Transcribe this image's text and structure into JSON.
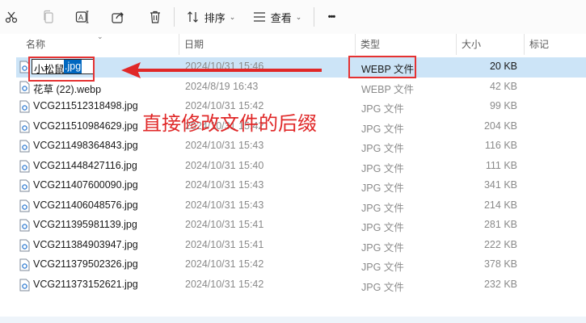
{
  "toolbar": {
    "sort_label": "排序",
    "view_label": "查看",
    "more_label": "•••"
  },
  "columns": {
    "name": "名称",
    "date": "日期",
    "type": "类型",
    "size": "大小",
    "tags": "标记"
  },
  "editing": {
    "plain": "小松鼠",
    "selected": ".jpg"
  },
  "annotation": "直接修改文件的后缀",
  "files": [
    {
      "name": "",
      "date": "2024/10/31 15:46",
      "type": "WEBP 文件",
      "size": "20 KB"
    },
    {
      "name": "花草 (22).webp",
      "date": "2024/8/19 16:43",
      "type": "WEBP 文件",
      "size": "42 KB"
    },
    {
      "name": "VCG211512318498.jpg",
      "date": "2024/10/31 15:42",
      "type": "JPG 文件",
      "size": "99 KB"
    },
    {
      "name": "VCG211510984629.jpg",
      "date": "2024/10/31 15:42",
      "type": "JPG 文件",
      "size": "204 KB"
    },
    {
      "name": "VCG211498364843.jpg",
      "date": "2024/10/31 15:43",
      "type": "JPG 文件",
      "size": "116 KB"
    },
    {
      "name": "VCG211448427116.jpg",
      "date": "2024/10/31 15:40",
      "type": "JPG 文件",
      "size": "111 KB"
    },
    {
      "name": "VCG211407600090.jpg",
      "date": "2024/10/31 15:43",
      "type": "JPG 文件",
      "size": "341 KB"
    },
    {
      "name": "VCG211406048576.jpg",
      "date": "2024/10/31 15:43",
      "type": "JPG 文件",
      "size": "214 KB"
    },
    {
      "name": "VCG211395981139.jpg",
      "date": "2024/10/31 15:41",
      "type": "JPG 文件",
      "size": "281 KB"
    },
    {
      "name": "VCG211384903947.jpg",
      "date": "2024/10/31 15:41",
      "type": "JPG 文件",
      "size": "222 KB"
    },
    {
      "name": "VCG211379502326.jpg",
      "date": "2024/10/31 15:42",
      "type": "JPG 文件",
      "size": "378 KB"
    },
    {
      "name": "VCG211373152621.jpg",
      "date": "2024/10/31 15:42",
      "type": "JPG 文件",
      "size": "232 KB"
    }
  ]
}
